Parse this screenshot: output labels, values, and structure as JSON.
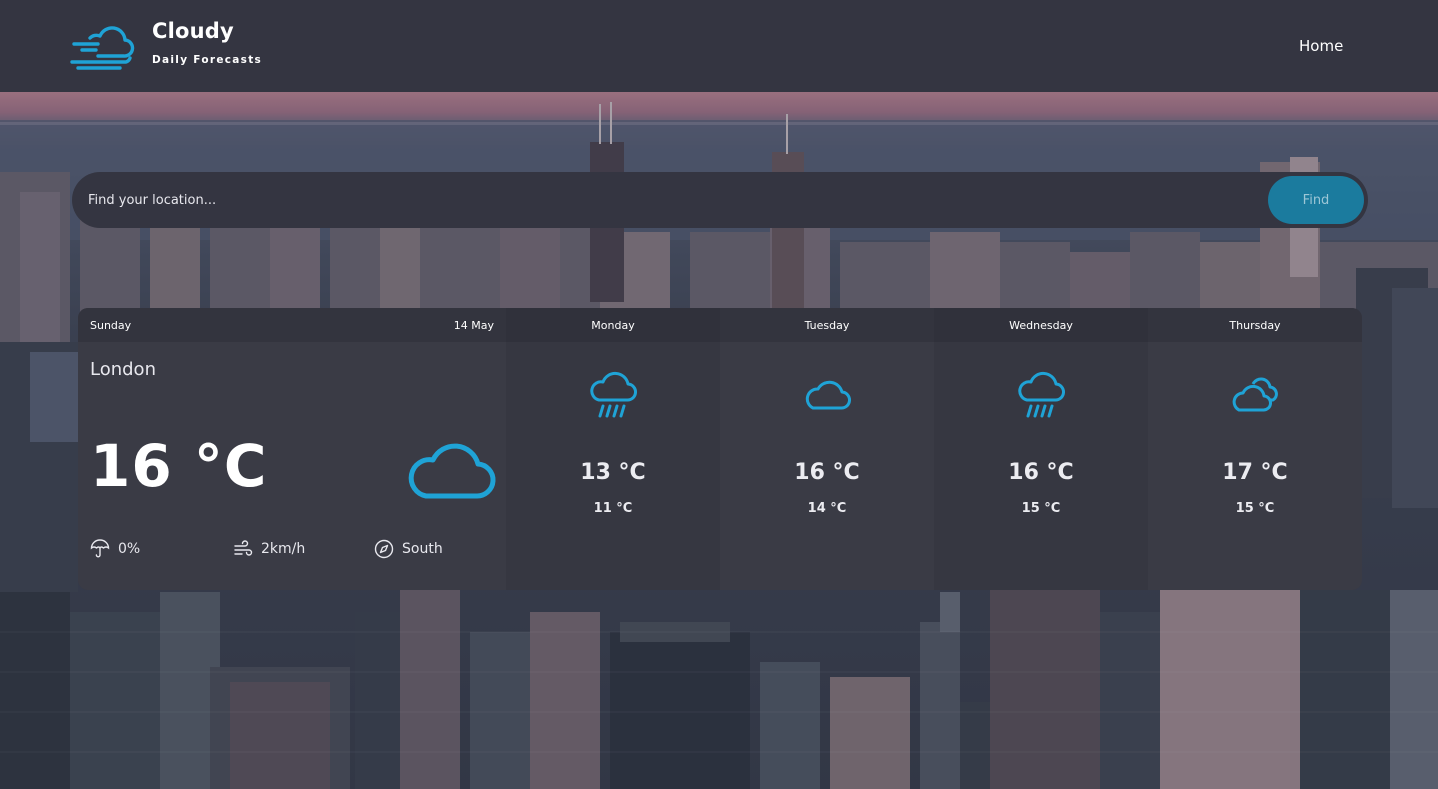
{
  "app": {
    "title": "Cloudy",
    "subtitle": "Daily Forecasts",
    "logo_icon": "wind-cloud-icon"
  },
  "nav": {
    "home_label": "Home"
  },
  "search": {
    "placeholder": "Find your location...",
    "button_label": "Find"
  },
  "colors": {
    "accent": "#1b7b9e",
    "icon": "#1fa3d6",
    "header_bg": "#343541"
  },
  "today": {
    "day": "Sunday",
    "date": "14 May",
    "city": "London",
    "temperature": "16 °C",
    "icon": "cloud-icon",
    "rain": "0%",
    "wind": "2km/h",
    "direction": "South"
  },
  "forecast": [
    {
      "day": "Monday",
      "icon": "rain-cloud-icon",
      "max": "13 °C",
      "min": "11 °C"
    },
    {
      "day": "Tuesday",
      "icon": "cloud-icon",
      "max": "16 °C",
      "min": "14 °C"
    },
    {
      "day": "Wednesday",
      "icon": "rain-cloud-icon",
      "max": "16 °C",
      "min": "15 °C"
    },
    {
      "day": "Thursday",
      "icon": "double-cloud-icon",
      "max": "17 °C",
      "min": "15 °C"
    }
  ]
}
